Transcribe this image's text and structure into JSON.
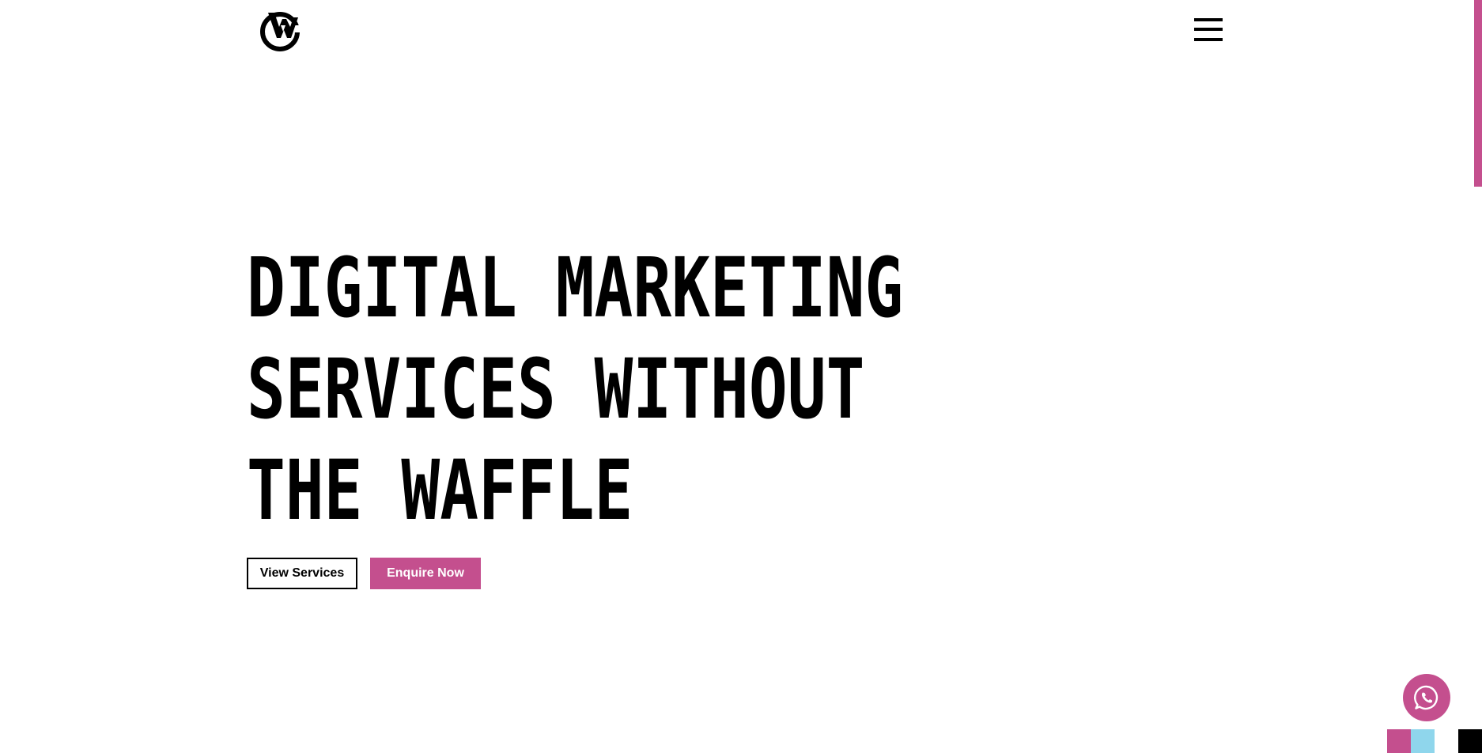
{
  "header": {
    "logo_icon": "wm-logo-icon",
    "menu_icon": "hamburger-menu-icon"
  },
  "hero": {
    "title_lines": [
      "DIGITAL MARKETING",
      "SERVICES WITHOUT",
      "THE WAFFLE"
    ],
    "buttons": {
      "view_services": "View Services",
      "enquire_now": "Enquire Now"
    }
  },
  "floating": {
    "whatsapp_icon": "whatsapp-icon"
  },
  "swatches": [
    {
      "name": "pink",
      "color": "#c44f8e"
    },
    {
      "name": "light-blue",
      "color": "#8fd6ec"
    },
    {
      "name": "black",
      "color": "#000000"
    }
  ],
  "colors": {
    "accent": "#c44f8e",
    "text": "#000000",
    "background": "#ffffff"
  }
}
